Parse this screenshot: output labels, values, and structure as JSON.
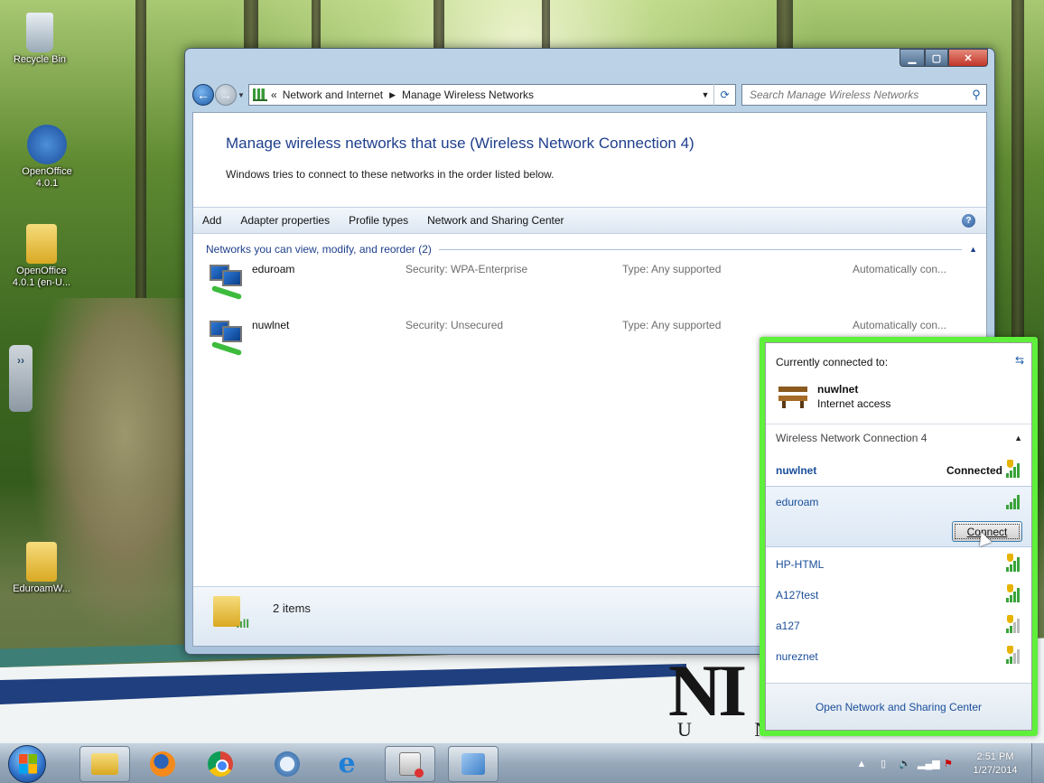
{
  "desktop": {
    "icons": [
      {
        "label": "Recycle Bin"
      },
      {
        "label": "OpenOffice 4.0.1"
      },
      {
        "label": "OpenOffice 4.0.1 (en-U..."
      },
      {
        "label": "EduroamW..."
      }
    ],
    "logo": {
      "big": "NI",
      "small": "U N"
    }
  },
  "window": {
    "address": {
      "prefix": "«",
      "crumbs": [
        "Network and Internet",
        "Manage Wireless Networks"
      ]
    },
    "search_placeholder": "Search Manage Wireless Networks",
    "title": "Manage wireless networks that use (Wireless Network Connection 4)",
    "description": "Windows tries to connect to these networks in the order listed below.",
    "toolbar": [
      "Add",
      "Adapter properties",
      "Profile types",
      "Network and Sharing Center"
    ],
    "group_label": "Networks you can view, modify, and reorder (2)",
    "networks": [
      {
        "name": "eduroam",
        "security": "Security: WPA-Enterprise",
        "type": "Type: Any supported",
        "mode": "Automatically con..."
      },
      {
        "name": "nuwlnet",
        "security": "Security: Unsecured",
        "type": "Type: Any supported",
        "mode": "Automatically con..."
      }
    ],
    "items_count": "2 items"
  },
  "flyout": {
    "header": "Currently connected to:",
    "current": {
      "name": "nuwlnet",
      "status": "Internet access"
    },
    "section": "Wireless Network Connection 4",
    "networks": [
      {
        "name": "nuwlnet",
        "status": "Connected",
        "strength": 4,
        "secured": false
      },
      {
        "name": "eduroam",
        "status": "",
        "strength": 4,
        "secured": true
      },
      {
        "name": "HP-HTML",
        "status": "",
        "strength": 4,
        "secured": false
      },
      {
        "name": "A127test",
        "status": "",
        "strength": 4,
        "secured": false
      },
      {
        "name": "a127",
        "status": "",
        "strength": 2,
        "secured": false
      },
      {
        "name": "nureznet",
        "status": "",
        "strength": 2,
        "secured": false
      }
    ],
    "connect_label": "Connect",
    "footer_link": "Open Network and Sharing Center"
  },
  "taskbar": {
    "clock": {
      "time": "2:51 PM",
      "date": "1/27/2014"
    }
  },
  "colors": {
    "highlight": "#5ef03a",
    "link": "#1a4e9a",
    "title": "#1e3f8c"
  }
}
